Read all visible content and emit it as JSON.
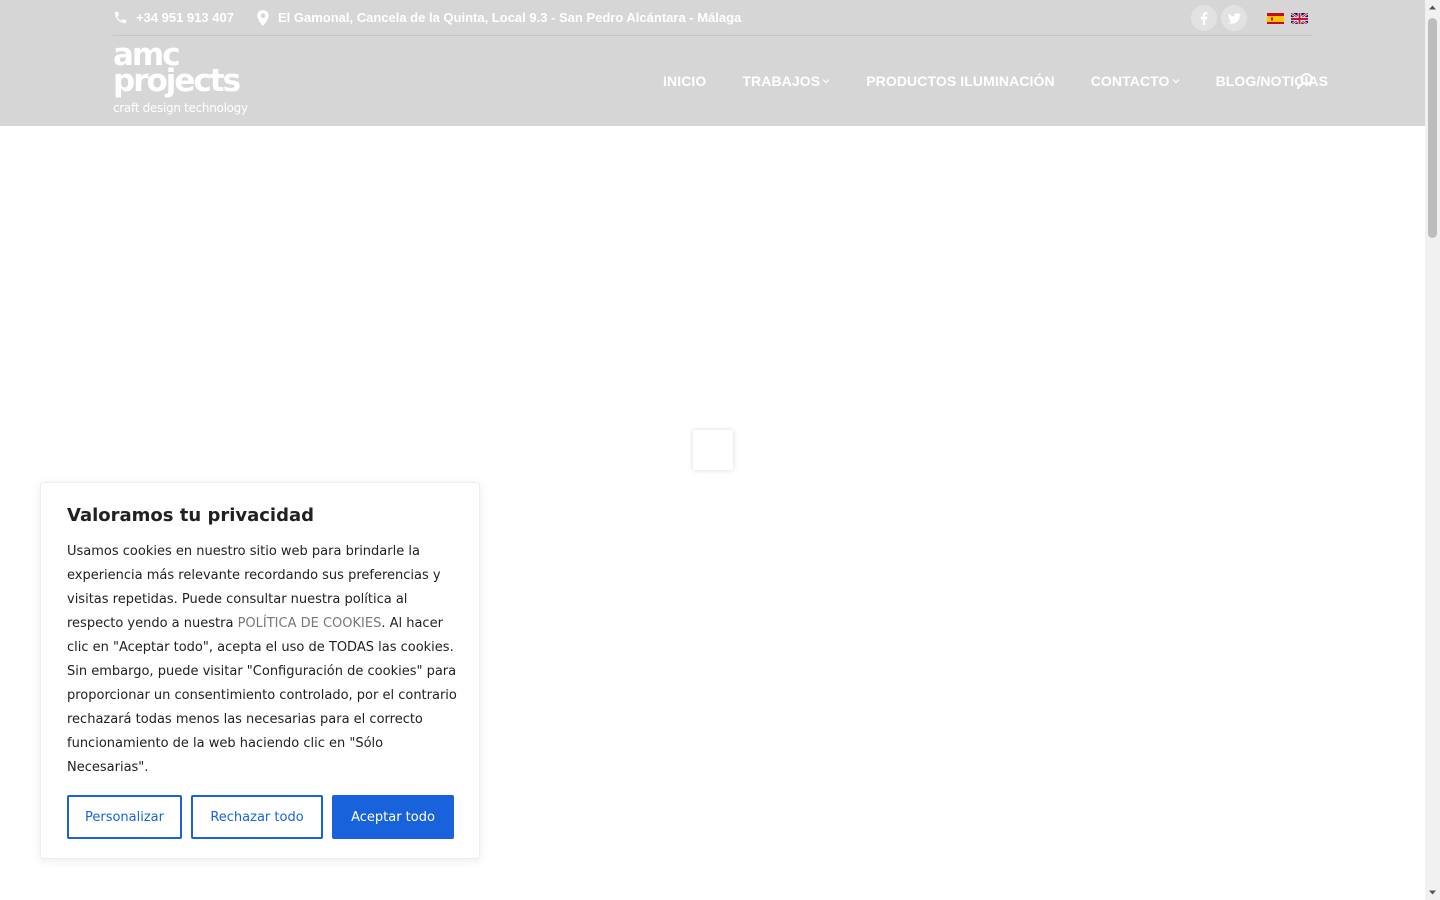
{
  "topbar": {
    "phone": "+34 951 913 407",
    "address": "El Gamonal, Cancela de la Quinta, Local 9.3 - San Pedro Alcántara - Málaga"
  },
  "logo": {
    "line1": "amc",
    "line2": "projects",
    "tagline": "craft design technology"
  },
  "nav": {
    "items": [
      {
        "label": "INICIO",
        "has_dropdown": false
      },
      {
        "label": "TRABAJOS",
        "has_dropdown": true
      },
      {
        "label": "PRODUCTOS ILUMINACIÓN",
        "has_dropdown": false
      },
      {
        "label": "CONTACTO",
        "has_dropdown": true
      },
      {
        "label": "BLOG/NOTICIAS",
        "has_dropdown": false
      }
    ]
  },
  "cookie": {
    "title": "Valoramos tu privacidad",
    "text_before_link": "Usamos cookies en nuestro sitio web para brindarle la experiencia más relevante recordando sus preferencias y visitas repetidas. Puede consultar nuestra política al respecto yendo a nuestra ",
    "link": "POLÍTICA DE COOKIES",
    "text_after_link": ". Al hacer clic en \"Aceptar todo\", acepta el uso de TODAS las cookies. Sin embargo, puede visitar \"Configuración de cookies\" para proporcionar un consentimiento controlado, por el contrario rechazará todas menos las necesarias para el correcto funcionamiento de la web haciendo clic en \"Sólo Necesarias\".",
    "buttons": {
      "customize": "Personalizar",
      "reject": "Rechazar todo",
      "accept": "Aceptar todo"
    }
  },
  "colors": {
    "header_bg": "#d6d6d6",
    "accent": "#1863dc"
  },
  "icons": {
    "phone": "phone-icon",
    "location": "location-pin-icon",
    "facebook": "facebook-icon",
    "twitter": "twitter-icon",
    "search": "search-icon",
    "flag_es": "spain-flag-icon",
    "flag_en": "uk-flag-icon"
  }
}
